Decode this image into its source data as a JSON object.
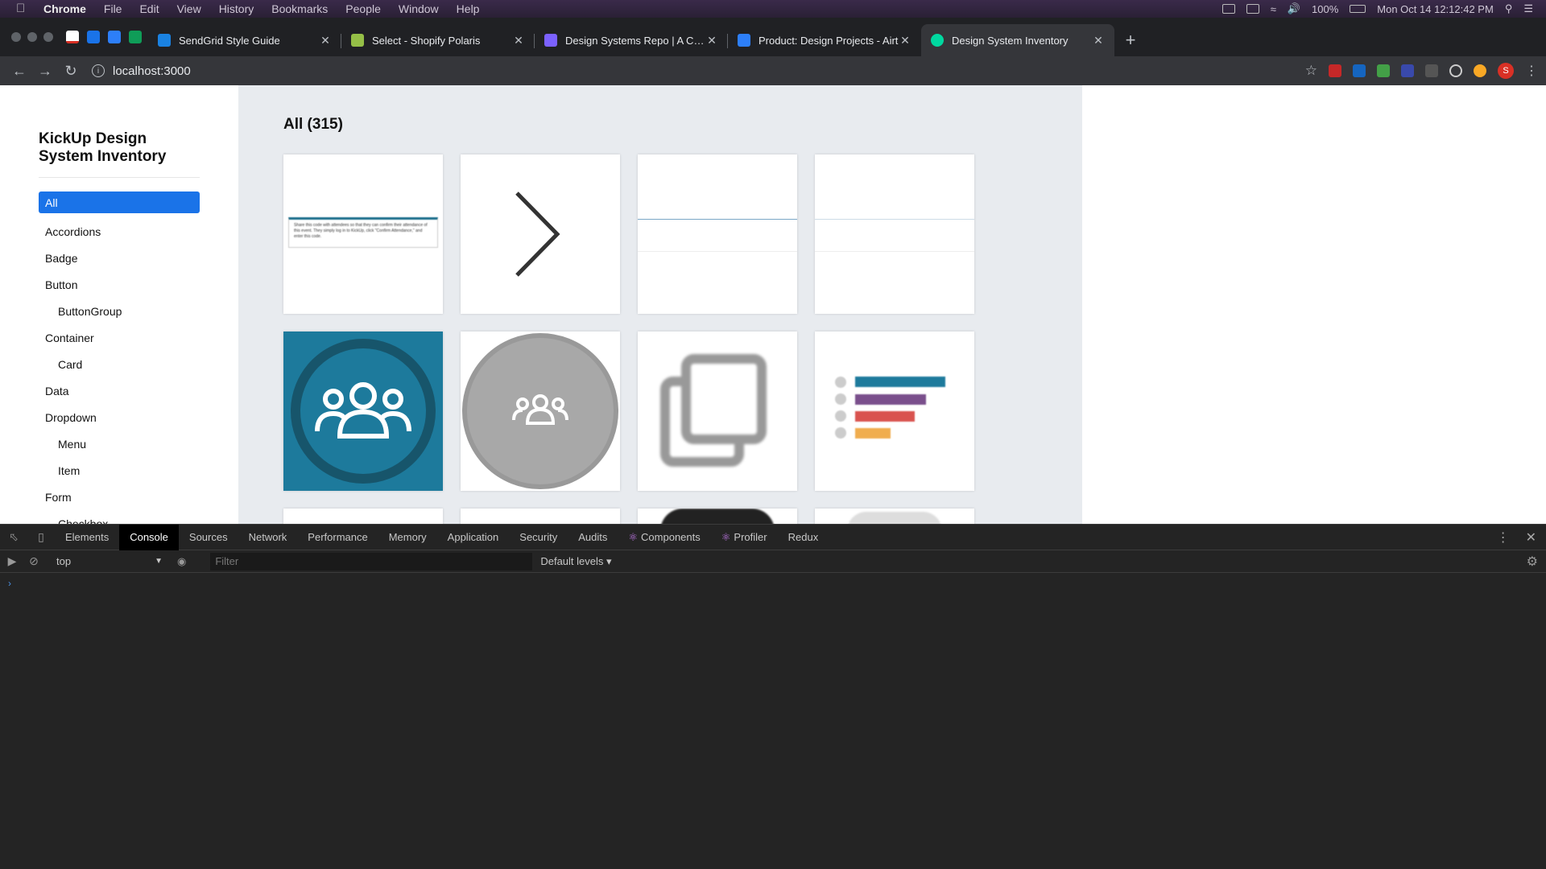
{
  "menubar": {
    "app": "Chrome",
    "items": [
      "File",
      "Edit",
      "View",
      "History",
      "Bookmarks",
      "People",
      "Window",
      "Help"
    ],
    "battery": "100%",
    "clock": "Mon Oct 14  12:12:42 PM"
  },
  "tabs": [
    {
      "title": "SendGrid Style Guide",
      "favicon_color": "#1a82e2"
    },
    {
      "title": "Select - Shopify Polaris",
      "favicon_color": "#95bf47"
    },
    {
      "title": "Design Systems Repo | A Colle",
      "favicon_color": "#7b61ff"
    },
    {
      "title": "Product: Design Projects - Airt",
      "favicon_color": "#2d7ff9"
    },
    {
      "title": "Design System Inventory",
      "favicon_color": "#00d8a0"
    }
  ],
  "address": {
    "url": "localhost:3000"
  },
  "sidebar": {
    "brand": "KickUp Design System Inventory",
    "items": [
      {
        "label": "All",
        "level": 0,
        "active": true
      },
      {
        "label": "Accordions",
        "level": 0
      },
      {
        "label": "Badge",
        "level": 0
      },
      {
        "label": "Button",
        "level": 0
      },
      {
        "label": "ButtonGroup",
        "level": 1
      },
      {
        "label": "Container",
        "level": 0
      },
      {
        "label": "Card",
        "level": 1
      },
      {
        "label": "Data",
        "level": 0
      },
      {
        "label": "Dropdown",
        "level": 0
      },
      {
        "label": "Menu",
        "level": 1
      },
      {
        "label": "Item",
        "level": 1
      },
      {
        "label": "Form",
        "level": 0
      },
      {
        "label": "Checkbox",
        "level": 1
      }
    ]
  },
  "main": {
    "title": "All (315)",
    "tooltip_text": "Share this code with attendees so that they can confirm their attendance of this event. They simply log in to KickUp, click \"Confirm Attendance,\" and enter this code.",
    "colors": {
      "teal": "#1d7a9c",
      "purple": "#7a4f8c",
      "red": "#d9534f",
      "yellow": "#f0ad4e"
    }
  },
  "devtools": {
    "tabs": [
      "Elements",
      "Console",
      "Sources",
      "Network",
      "Performance",
      "Memory",
      "Application",
      "Security",
      "Audits",
      "Components",
      "Profiler",
      "Redux"
    ],
    "active_tab": "Console",
    "context": "top",
    "filter_placeholder": "Filter",
    "levels": "Default levels"
  }
}
